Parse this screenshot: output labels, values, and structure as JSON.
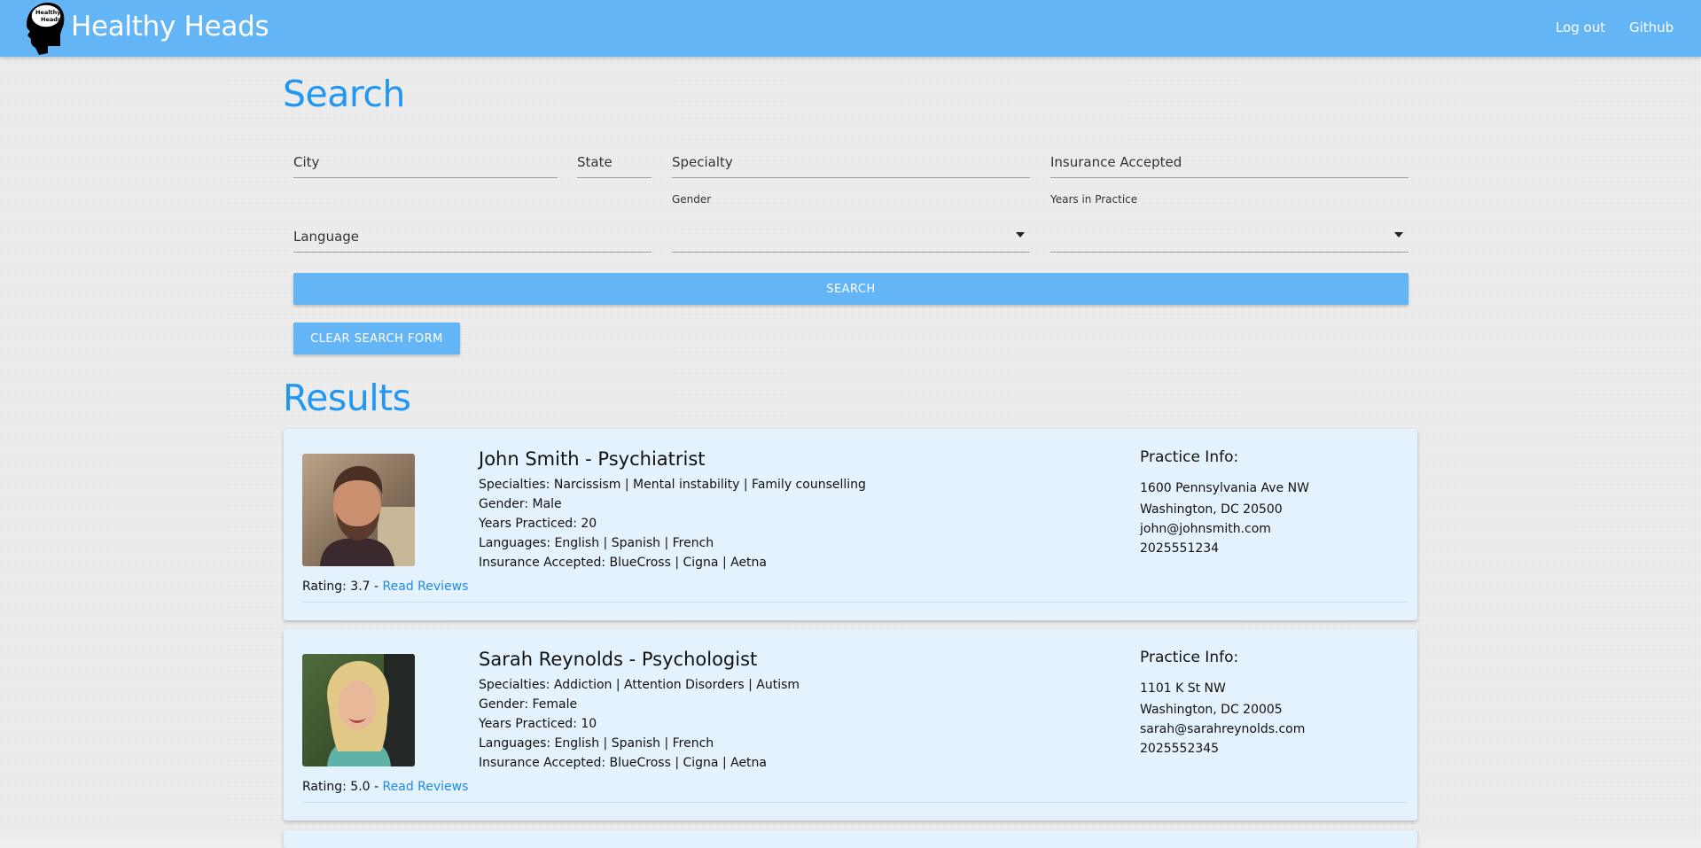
{
  "navbar": {
    "logo_text_1": "Healthy",
    "logo_text_2": "Heads",
    "brand": "Healthy Heads",
    "logout": "Log out",
    "github": "Github",
    "color": "#64b5f6"
  },
  "search": {
    "heading": "Search",
    "fields": {
      "city": "City",
      "state": "State",
      "specialty": "Specialty",
      "insurance": "Insurance Accepted",
      "language": "Language",
      "gender_label": "Gender",
      "gender_value": "",
      "years_label": "Years in Practice",
      "years_value": ""
    },
    "search_button": "SEARCH",
    "clear_button": "CLEAR SEARCH FORM"
  },
  "results": {
    "heading": "Results",
    "items": [
      {
        "name": "John Smith - Psychiatrist",
        "specialties": "Specialties: Narcissism | Mental instability | Family counselling",
        "gender": "Gender: Male",
        "years": "Years Practiced: 20",
        "languages": "Languages: English | Spanish | French",
        "insurance": "Insurance Accepted: BlueCross | Cigna | Aetna",
        "rating_prefix": "Rating: 3.7 - ",
        "read_reviews": "Read Reviews",
        "practice_title": "Practice Info:",
        "address1": "1600 Pennsylvania Ave NW",
        "address2": "Washington, DC 20500",
        "email": "john@johnsmith.com",
        "phone": "2025551234"
      },
      {
        "name": "Sarah Reynolds - Psychologist",
        "specialties": "Specialties: Addiction | Attention Disorders | Autism",
        "gender": "Gender: Female",
        "years": "Years Practiced: 10",
        "languages": "Languages: English | Spanish | French",
        "insurance": "Insurance Accepted: BlueCross | Cigna | Aetna",
        "rating_prefix": "Rating: 5.0 - ",
        "read_reviews": "Read Reviews",
        "practice_title": "Practice Info:",
        "address1": "1101 K St NW",
        "address2": "Washington, DC 20005",
        "email": "sarah@sarahreynolds.com",
        "phone": "2025552345"
      }
    ]
  },
  "colors": {
    "accent": "#2196f3",
    "card_bg": "#e3f2fd",
    "link": "#1e88e5"
  }
}
